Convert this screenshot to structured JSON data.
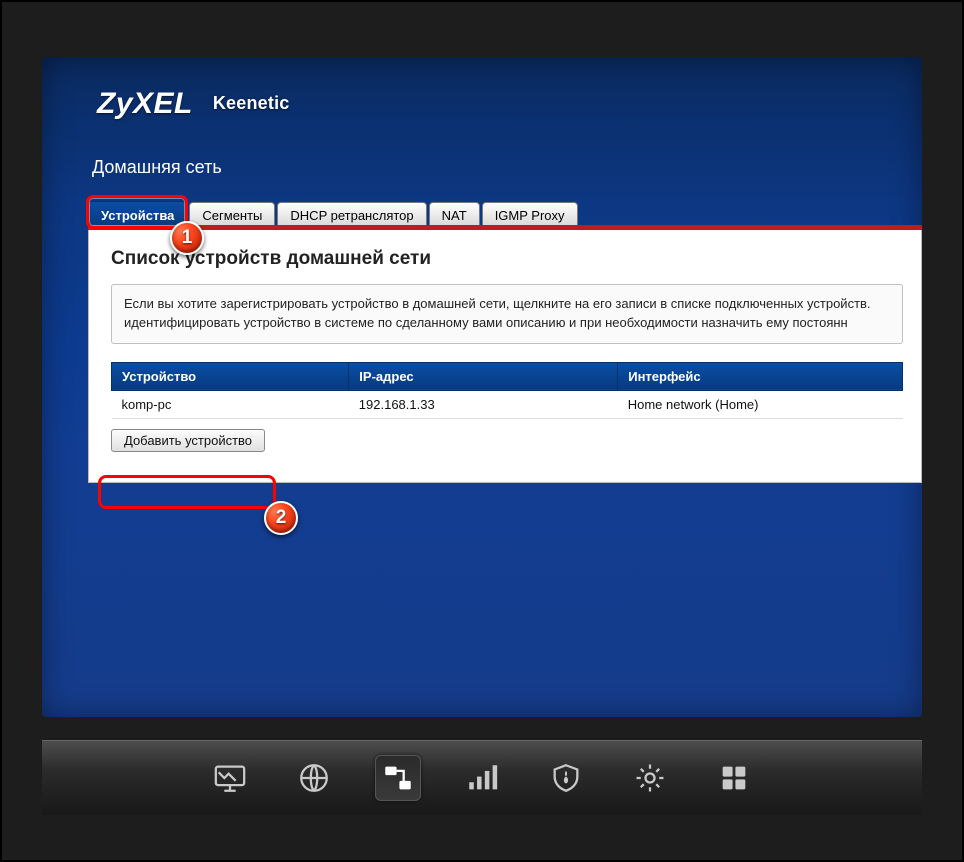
{
  "brand": {
    "name": "ZyXEL",
    "model": "Keenetic"
  },
  "page_title": "Домашняя сеть",
  "tabs": [
    {
      "label": "Устройства",
      "active": true
    },
    {
      "label": "Сегменты",
      "active": false
    },
    {
      "label": "DHCP ретранслятор",
      "active": false
    },
    {
      "label": "NAT",
      "active": false
    },
    {
      "label": "IGMP Proxy",
      "active": false
    }
  ],
  "section_title": "Список устройств домашней сети",
  "info_text": "Если вы хотите зарегистрировать устройство в домашней сети, щелкните на его записи в списке подключенных устройств. идентифицировать устройство в системе по сделанному вами описанию и при необходимости назначить ему постоянн",
  "table": {
    "headers": {
      "device": "Устройство",
      "ip": "IP-адрес",
      "iface": "Интерфейс"
    },
    "rows": [
      {
        "device": "komp-pc",
        "ip": "192.168.1.33",
        "iface": "Home network (Home)"
      }
    ]
  },
  "add_button": "Добавить устройство",
  "markers": {
    "m1": "1",
    "m2": "2"
  },
  "dock": {
    "items": [
      {
        "name": "monitor-icon"
      },
      {
        "name": "globe-icon"
      },
      {
        "name": "network-icon"
      },
      {
        "name": "signal-icon"
      },
      {
        "name": "shield-icon"
      },
      {
        "name": "gear-icon"
      },
      {
        "name": "apps-icon"
      }
    ],
    "active_index": 2
  }
}
